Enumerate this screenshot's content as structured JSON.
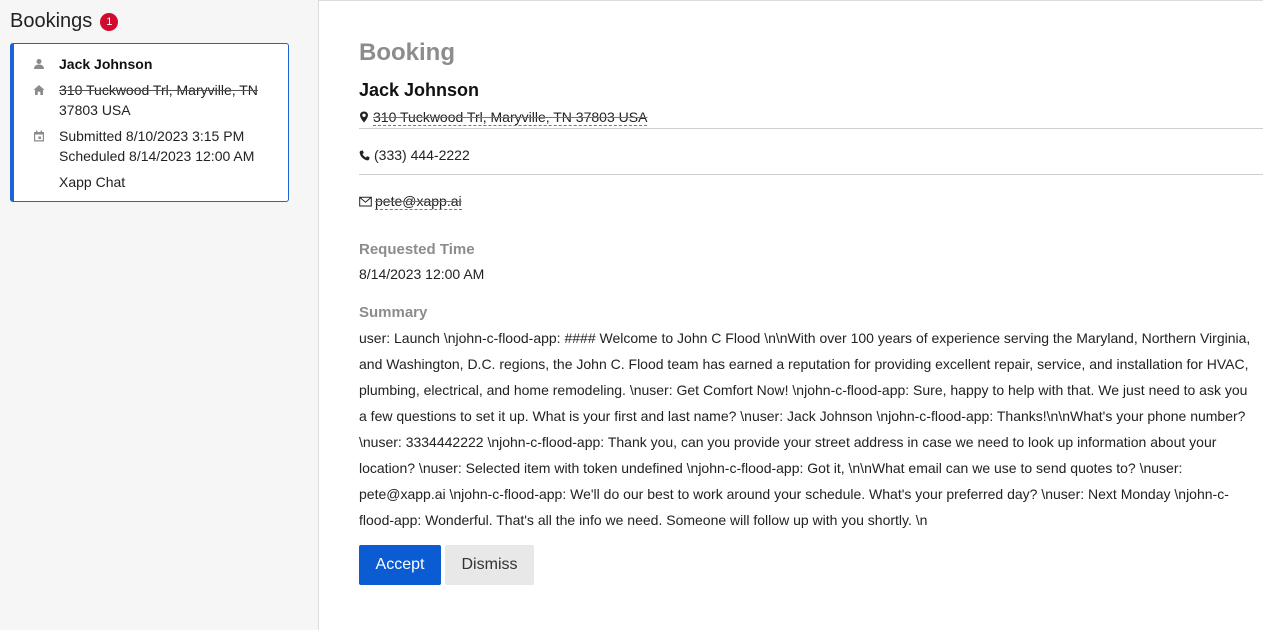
{
  "sidebar": {
    "title": "Bookings",
    "badge_count": "1",
    "bookings": [
      {
        "name": "Jack Johnson",
        "address_line1": "310 Tuckwood Trl, Maryville, TN",
        "address_line2": "37803 USA",
        "submitted": "Submitted 8/10/2023 3:15 PM",
        "scheduled": "Scheduled 8/14/2023 12:00 AM",
        "channel": "Xapp Chat"
      }
    ]
  },
  "booking": {
    "title": "Booking",
    "name": "Jack Johnson",
    "address": "310 Tuckwood Trl, Maryville, TN 37803 USA",
    "phone": "(333) 444-2222",
    "email": "pete@xapp.ai",
    "requested_time_label": "Requested Time",
    "requested_time": "8/14/2023 12:00 AM",
    "summary_label": "Summary",
    "summary": "user: Launch \\njohn-c-flood-app: #### Welcome to John C Flood \\n\\nWith over 100 years of experience serving the Maryland, Northern Virginia, and Washington, D.C. regions, the John C. Flood team has earned a reputation for providing excellent repair, service, and installation for HVAC, plumbing, electrical, and home remodeling. \\nuser: Get Comfort Now! \\njohn-c-flood-app: Sure, happy to help with that. We just need to ask you a few questions to set it up. What is your first and last name? \\nuser: Jack Johnson \\njohn-c-flood-app: Thanks!\\n\\nWhat's your phone number? \\nuser: 3334442222 \\njohn-c-flood-app: Thank you, can you provide your street address in case we need to look up information about your location? \\nuser: Selected item with token undefined \\njohn-c-flood-app: Got it, \\n\\nWhat email can we use to send quotes to? \\nuser: pete@xapp.ai \\njohn-c-flood-app: We'll do our best to work around your schedule. What's your preferred day? \\nuser: Next Monday \\njohn-c-flood-app: Wonderful. That's all the info we need. Someone will follow up with you shortly. \\n"
  },
  "actions": {
    "accept_label": "Accept",
    "dismiss_label": "Dismiss"
  },
  "icons": {
    "person": "person-icon",
    "home": "home-icon",
    "calendar": "calendar-icon",
    "location": "map-marker-icon",
    "phone": "phone-icon",
    "email": "envelope-icon"
  },
  "colors": {
    "accent": "#0b5bd3",
    "badge": "#d10a2f",
    "card_border": "#1b63d6",
    "muted_heading": "#8c8c8c"
  }
}
